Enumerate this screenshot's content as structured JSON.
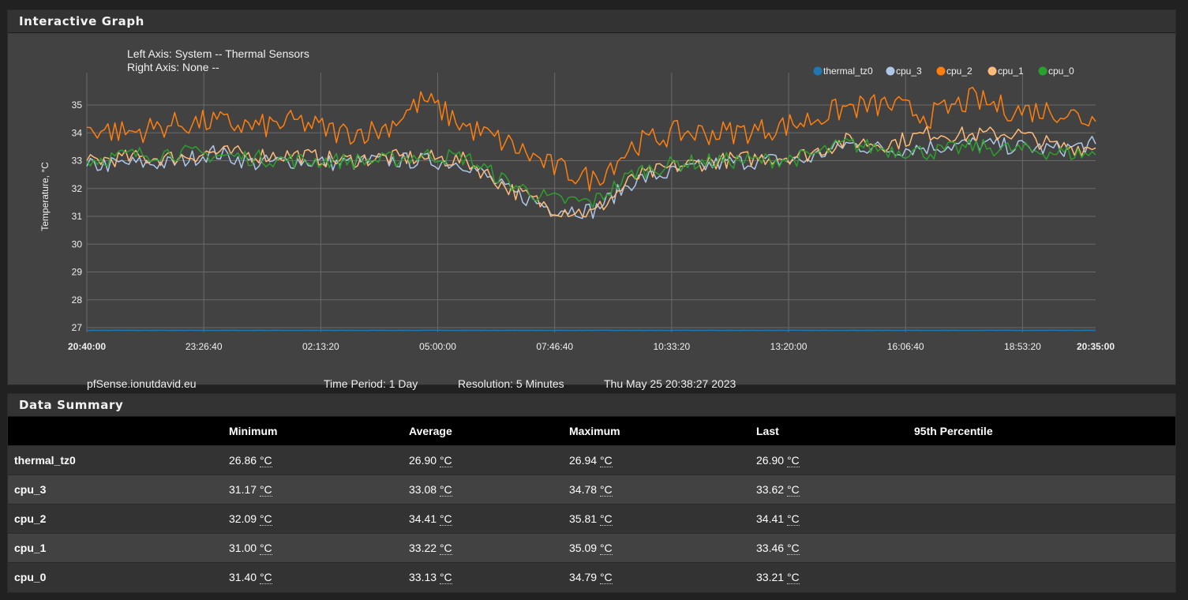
{
  "graph_panel": {
    "title": "Interactive Graph"
  },
  "summary_panel": {
    "title": "Data Summary"
  },
  "footer": {
    "host": "pfSense.ionutdavid.eu",
    "time_period": "Time Period: 1 Day",
    "resolution": "Resolution: 5 Minutes",
    "timestamp": "Thu May 25 20:38:27 2023"
  },
  "chart_data": {
    "type": "line",
    "title": "Left Axis: System -- Thermal Sensors",
    "subtitle": "Right Axis: None --",
    "xlabel": "",
    "ylabel": "Temperature, °C",
    "ylim": [
      27,
      35
    ],
    "yticks": [
      "35",
      "34",
      "33",
      "32",
      "31",
      "30",
      "29",
      "28",
      "27"
    ],
    "xticks": [
      "20:40:00",
      "23:26:40",
      "02:13:20",
      "05:00:00",
      "07:46:40",
      "10:33:20",
      "13:20:00",
      "16:06:40",
      "18:53:20",
      "20:35:00"
    ],
    "grid": true,
    "legend_position": "top-right",
    "x_keyframes_hours": [
      0,
      1,
      2,
      3,
      4,
      5,
      6,
      7,
      8,
      9,
      10,
      11,
      12,
      13,
      14,
      15,
      16,
      17,
      18,
      19,
      20,
      21,
      22,
      23,
      23.92
    ],
    "series": [
      {
        "name": "thermal_tz0",
        "color": "#1f77b4",
        "values": [
          26.9,
          26.9,
          26.9,
          26.9,
          26.9,
          26.9,
          26.9,
          26.9,
          26.9,
          26.9,
          26.9,
          26.9,
          26.9,
          26.9,
          26.9,
          26.9,
          26.9,
          26.9,
          26.9,
          26.9,
          26.9,
          26.9,
          26.9,
          26.9,
          26.9
        ]
      },
      {
        "name": "cpu_3",
        "color": "#aec7e8",
        "values": [
          32.8,
          32.9,
          32.9,
          33.3,
          32.9,
          33.0,
          32.9,
          33.0,
          33.0,
          32.9,
          31.9,
          31.3,
          31.2,
          32.3,
          32.6,
          32.9,
          33.0,
          33.0,
          33.6,
          33.4,
          33.5,
          33.6,
          33.5,
          33.4,
          33.6
        ]
      },
      {
        "name": "cpu_2",
        "color": "#ff7f0e",
        "values": [
          34.2,
          34.0,
          34.3,
          34.4,
          34.2,
          34.4,
          34.0,
          34.1,
          35.2,
          34.2,
          33.6,
          32.8,
          32.3,
          33.6,
          34.0,
          34.0,
          34.1,
          34.4,
          34.9,
          35.0,
          34.6,
          35.2,
          34.8,
          34.8,
          34.41
        ]
      },
      {
        "name": "cpu_1",
        "color": "#ffbb78",
        "values": [
          33.0,
          33.1,
          33.1,
          33.3,
          33.2,
          33.2,
          33.0,
          33.1,
          33.1,
          33.0,
          32.0,
          31.3,
          31.1,
          32.4,
          32.8,
          33.0,
          33.1,
          33.2,
          33.7,
          33.6,
          34.0,
          33.9,
          34.0,
          33.5,
          33.46
        ]
      },
      {
        "name": "cpu_0",
        "color": "#2ca02c",
        "values": [
          33.0,
          33.2,
          33.3,
          33.2,
          33.1,
          33.0,
          33.0,
          33.0,
          33.2,
          33.1,
          32.2,
          31.6,
          31.5,
          32.6,
          32.9,
          33.0,
          33.0,
          33.1,
          33.6,
          33.4,
          33.3,
          33.5,
          33.4,
          33.3,
          33.21
        ]
      }
    ]
  },
  "summary": {
    "headers": [
      "",
      "Minimum",
      "Average",
      "Maximum",
      "Last",
      "95th Percentile"
    ],
    "unit": "°C",
    "rows": [
      {
        "name": "thermal_tz0",
        "min": "26.86",
        "avg": "26.90",
        "max": "26.94",
        "last": "26.90",
        "p95": ""
      },
      {
        "name": "cpu_3",
        "min": "31.17",
        "avg": "33.08",
        "max": "34.78",
        "last": "33.62",
        "p95": ""
      },
      {
        "name": "cpu_2",
        "min": "32.09",
        "avg": "34.41",
        "max": "35.81",
        "last": "34.41",
        "p95": ""
      },
      {
        "name": "cpu_1",
        "min": "31.00",
        "avg": "33.22",
        "max": "35.09",
        "last": "33.46",
        "p95": ""
      },
      {
        "name": "cpu_0",
        "min": "31.40",
        "avg": "33.13",
        "max": "34.79",
        "last": "33.21",
        "p95": ""
      }
    ]
  }
}
